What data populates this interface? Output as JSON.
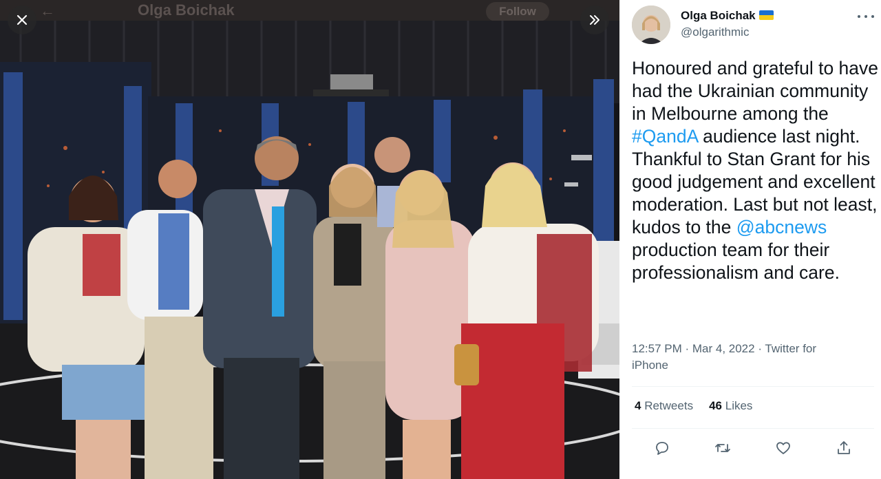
{
  "background": {
    "ghost_name": "Olga Boichak",
    "ghost_follow": "Follow"
  },
  "viewer": {
    "close_icon": "close-icon",
    "expand_icon": "chevrons-right-icon",
    "photo_description_icon": "photo"
  },
  "tweet": {
    "author_name": "Olga Boichak",
    "author_handle": "@olgarithmic",
    "text_parts": {
      "p1": "Honoured and grateful to have had the Ukrainian community in Melbourne among the ",
      "hashtag": "#QandA",
      "p2": " audience last night. Thankful to Stan Grant for his good judgement and excellent moderation. Last but not least, kudos to the ",
      "mention": "@abcnews",
      "p3": " production team for their professionalism and care."
    },
    "timestamp": "12:57 PM · Mar 4, 2022",
    "separator": " · ",
    "source": "Twitter for iPhone",
    "retweets_count": "4",
    "retweets_label": "Retweets",
    "likes_count": "46",
    "likes_label": "Likes"
  },
  "actions": {
    "reply_icon": "reply-icon",
    "retweet_icon": "retweet-icon",
    "like_icon": "heart-icon",
    "share_icon": "share-icon"
  },
  "colors": {
    "link": "#1d9bf0",
    "text": "#0f1419",
    "muted": "#536471",
    "flag_blue": "#1a6fd0",
    "flag_yellow": "#f5cc1a"
  }
}
